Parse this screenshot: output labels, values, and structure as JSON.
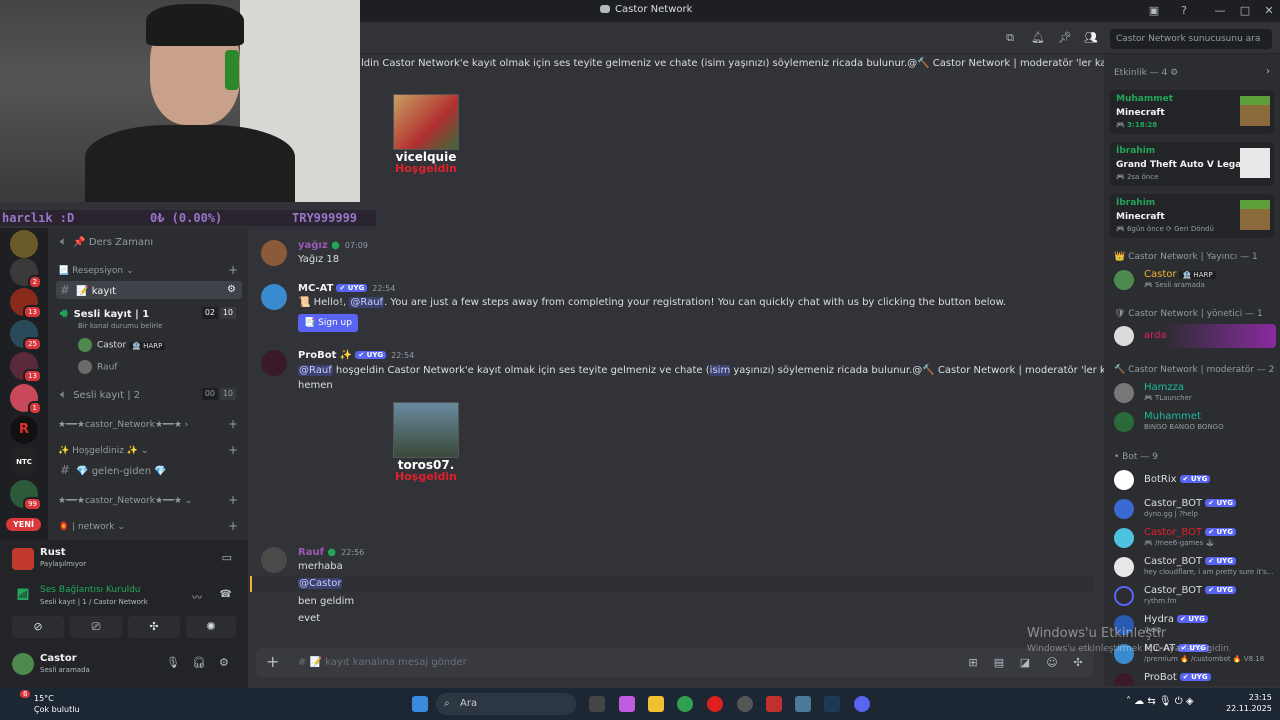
{
  "window": {
    "title": "Castor Network"
  },
  "search": {
    "placeholder": "Castor Network sunucusunu ara"
  },
  "overlay": {
    "donate_left": "harclık :D",
    "donate_mid": "0₺ (0.00%)",
    "donate_right": "TRY999999"
  },
  "rail": {
    "badges": [
      "2",
      "13",
      "25",
      "13",
      "1",
      "99"
    ],
    "r_logo": "R",
    "ntc_logo": "NTC",
    "yeni": "YENİ"
  },
  "sidebar": {
    "ders_zamani": "📌 Ders Zamanı",
    "cat_resepsiyon": "📃 Resepsiyon",
    "ch_kayit": "📝 kayıt",
    "voice1": "Sesli kayıt | 1",
    "voice1_status": "Bir kanal durumu belirle",
    "voice1_counts": [
      "02",
      "10"
    ],
    "voice_users": [
      {
        "name": "Castor",
        "badge": "🏦 HARP"
      },
      {
        "name": "Rauf",
        "badge": ""
      }
    ],
    "voice2": "Sesli kayıt | 2",
    "voice2_counts": [
      "00",
      "10"
    ],
    "cat_network1": "★━━★castor_Network★━━★",
    "cat_hosgeldiniz": "✨ Hoşgeldiniz ✨",
    "ch_gelen": "💎 gelen-giden 💎",
    "cat_network2": "★━━★castor_Network★━━★",
    "cat_network3": "🏮 | network"
  },
  "activity_panel": {
    "title": "Rust",
    "subtitle": "Paylaşılmıyor"
  },
  "voice_panel": {
    "title": "Ses Bağlantısı Kuruldu",
    "subtitle": "Sesli kayıt | 1 / Castor Network"
  },
  "user_panel": {
    "name": "Castor",
    "status": "Sesli aramada"
  },
  "messages": {
    "top_text": "ldin Castor Network'e kayıt olmak için ses teyite gelmeniz ve chate (isim yaşınızı) söylemeniz ricada bulunur.@🔨 Castor Network | moderatör 'ler kayıt edin",
    "card1": {
      "name": "vicelquie",
      "sub": "Hoşgeldin"
    },
    "m1": {
      "user": "yağız",
      "time": "07:09",
      "text": "Yağız 18"
    },
    "m2": {
      "user": "MC-AT",
      "tag": "✔ UYG",
      "time": "22:54",
      "pre": "📜 Hello!,",
      "mention": "@Rauf",
      "post": ". You are just a few steps away from completing your registration! You can quickly chat with us by clicking the button below.",
      "button": "📑 Sign up"
    },
    "m3": {
      "user": "ProBot ✨",
      "tag": "✔ UYG",
      "time": "22:54",
      "mention": "@Rauf",
      "l1a": " hoşgeldin Castor Network'e kayıt olmak için ses teyite gelmeniz ve chate (",
      "l1sel": "isim",
      "l1b": " yaşınızı) söylemeniz ricada bulunur.@🔨 Castor Network | moderatör 'ler kayıt edin",
      "l2": "hemen"
    },
    "card2": {
      "name": "toros07.",
      "sub": "Hoşgeldin"
    },
    "m4": {
      "user": "Rauf",
      "time": "22:56",
      "l1": "merhaba",
      "mention": "@Castor",
      "l3": "ben geldim",
      "l4": "evet"
    }
  },
  "composer": {
    "placeholder": "# 📝 kayıt kanalına mesaj gönder"
  },
  "members": {
    "activity_header": "Etkinlik — 4 ⚙",
    "activities": [
      {
        "user": "Muhammet",
        "game": "Minecraft",
        "detail": "🎮 3:18:28"
      },
      {
        "user": "İbrahim",
        "game": "Grand Theft Auto V Legacy",
        "detail": "🎮 2sa önce"
      },
      {
        "user": "İbrahim",
        "game": "Minecraft",
        "detail": "🎮 6gün önce  ⟳ Geri Döndü"
      }
    ],
    "sec_yayinci": "👑 Castor Network | Yayıncı — 1",
    "yayinci": {
      "name": "Castor",
      "badge": "🏦 HARP",
      "status": "🎮 Sesli aramada"
    },
    "sec_yonetici": "🛡 Castor Network | yönetici — 1",
    "yonetici": {
      "name": "arda"
    },
    "sec_moderator": "🔨 Castor Network | moderatör — 2",
    "moderators": [
      {
        "name": "Hamzza",
        "status": "🎮 TLauncher"
      },
      {
        "name": "Muhammet",
        "status": "BINGO BANGO BONGO"
      }
    ],
    "sec_bot": "• Bot — 9",
    "bots": [
      {
        "name": "BotRix",
        "tag": "✔ UYG",
        "status": ""
      },
      {
        "name": "Castor_BOT",
        "tag": "✔ UYG",
        "status": "dyno.gg | ?help"
      },
      {
        "name": "Castor_BOT",
        "tag": "✔ UYG",
        "status": "🎮 /mee6-games 🕹"
      },
      {
        "name": "Castor_BOT",
        "tag": "✔ UYG",
        "status": "hey cloudflare, i am pretty sure it's..."
      },
      {
        "name": "Castor_BOT",
        "tag": "✔ UYG",
        "status": "rythm.fm"
      },
      {
        "name": "Hydra",
        "tag": "✔ UYG",
        "status": "/help"
      },
      {
        "name": "MC-AT",
        "tag": "✔ UYG",
        "status": "/premium 🔥 /custombot 🔥 V8.18"
      },
      {
        "name": "ProBot",
        "tag": "✔ UYG",
        "status": ""
      }
    ]
  },
  "watermark": {
    "title": "Windows'u Etkinleştir",
    "sub": "Windows'u etkinleştirmek için Ayarlar'a gidin."
  },
  "taskbar": {
    "weather_temp": "15°C",
    "weather_desc": "Çok bulutlu",
    "weather_badge": "6",
    "search": "Ara",
    "time": "23:15",
    "date": "22.11.2025"
  },
  "colors": {
    "bg": "#313338",
    "sidebar": "#2b2d31",
    "rail": "#1e1f22",
    "accent": "#5865f2",
    "green": "#23a55a",
    "mod_color": "#1abc9c",
    "red_name": "#e0202a"
  }
}
